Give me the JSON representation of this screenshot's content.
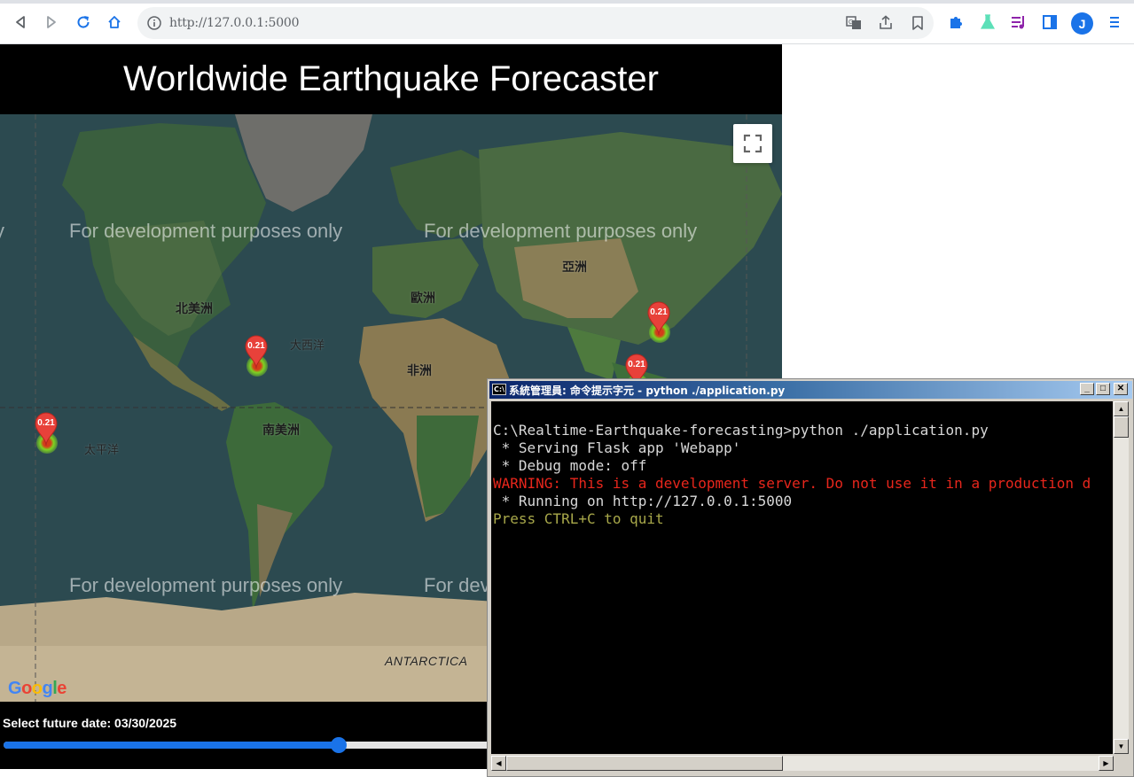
{
  "browser": {
    "url": "http://127.0.0.1:5000",
    "avatar_letter": "J",
    "accent_color": "#1a73e8"
  },
  "page": {
    "title": "Worldwide Earthquake Forecaster",
    "watermark": "For development purposes only",
    "date_label": "Select future date: 03/30/2025",
    "slider_fraction": 0.43,
    "google_logo": "Google"
  },
  "map": {
    "labels": {
      "north_america": "北美洲",
      "south_america": "南美洲",
      "europe": "歐洲",
      "asia": "亞洲",
      "africa": "非洲",
      "atlantic": "大西洋",
      "pacific": "太平洋",
      "antarctica": "ANTARCTICA"
    },
    "markers": [
      {
        "value": "0.21"
      },
      {
        "value": "0.21"
      },
      {
        "value": "0.21"
      },
      {
        "value": "0.21"
      }
    ]
  },
  "console": {
    "title": "系統管理員: 命令提示字元 - python  ./application.py",
    "lines": [
      {
        "text": "C:\\Realtime-Earthquake-forecasting>python ./application.py",
        "color": "#d8d8d8"
      },
      {
        "text": " * Serving Flask app 'Webapp'",
        "color": "#d8d8d8"
      },
      {
        "text": " * Debug mode: off",
        "color": "#d8d8d8"
      },
      {
        "text": "WARNING: This is a development server. Do not use it in a production d",
        "color": "#e8261c"
      },
      {
        "text": " * Running on http://127.0.0.1:5000",
        "color": "#d8d8d8"
      },
      {
        "text": "Press CTRL+C to quit",
        "color": "#a8a84a"
      }
    ]
  }
}
